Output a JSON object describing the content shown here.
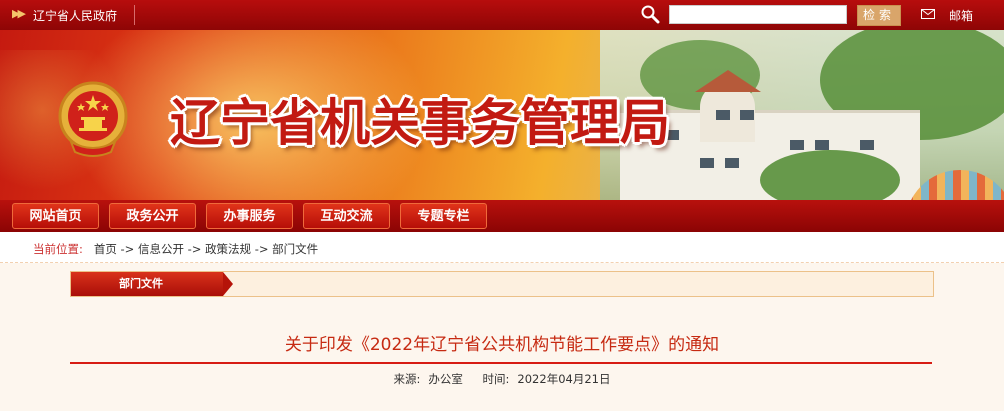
{
  "topbar": {
    "home_link": "辽宁省人民政府",
    "search_placeholder": "",
    "search_button": "检索",
    "mail_link": "邮箱"
  },
  "banner": {
    "title": "辽宁省机关事务管理局"
  },
  "nav": {
    "items": [
      {
        "label": "网站首页"
      },
      {
        "label": "政务公开"
      },
      {
        "label": "办事服务"
      },
      {
        "label": "互动交流"
      },
      {
        "label": "专题专栏"
      }
    ]
  },
  "breadcrumb": {
    "label": "当前位置:",
    "items": [
      "首页",
      "信息公开",
      "政策法规",
      "部门文件"
    ],
    "separator": "->"
  },
  "content": {
    "tab_label": "部门文件",
    "doc_title": "关于印发《2022年辽宁省公共机构节能工作要点》的通知",
    "source_label": "来源:",
    "source_value": "办公室",
    "time_label": "时间:",
    "time_value": "2022年04月21日"
  },
  "colors": {
    "brand_red": "#b70d0d",
    "title_red": "#c62a12",
    "button_gold": "#d9a56a"
  }
}
